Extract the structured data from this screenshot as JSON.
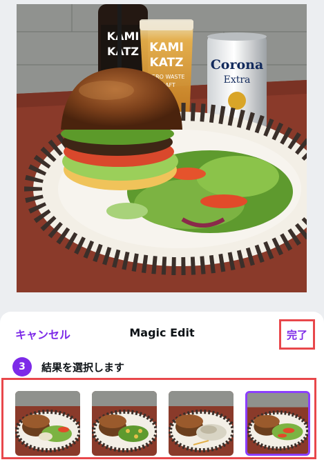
{
  "main_photo": {
    "bottle_text": [
      "KAMI",
      "KATZ"
    ],
    "glass_text": [
      "KAMI",
      "KATZ",
      "ZERO WASTE",
      "CRAFT"
    ],
    "can_text": [
      "Corona",
      "Extra"
    ]
  },
  "sheet": {
    "cancel_label": "キャンセル",
    "title": "Magic Edit",
    "done_label": "完了",
    "step_number": "3",
    "step_label": "結果を選択します"
  },
  "results": [
    {
      "name": "result-1",
      "selected": false
    },
    {
      "name": "result-2",
      "selected": false
    },
    {
      "name": "result-3",
      "selected": false
    },
    {
      "name": "result-4",
      "selected": true
    }
  ],
  "colors": {
    "accent": "#7d2ae8",
    "highlight_border": "#e8474b",
    "sheet_bg": "#ffffff",
    "page_bg": "#eceef1"
  }
}
